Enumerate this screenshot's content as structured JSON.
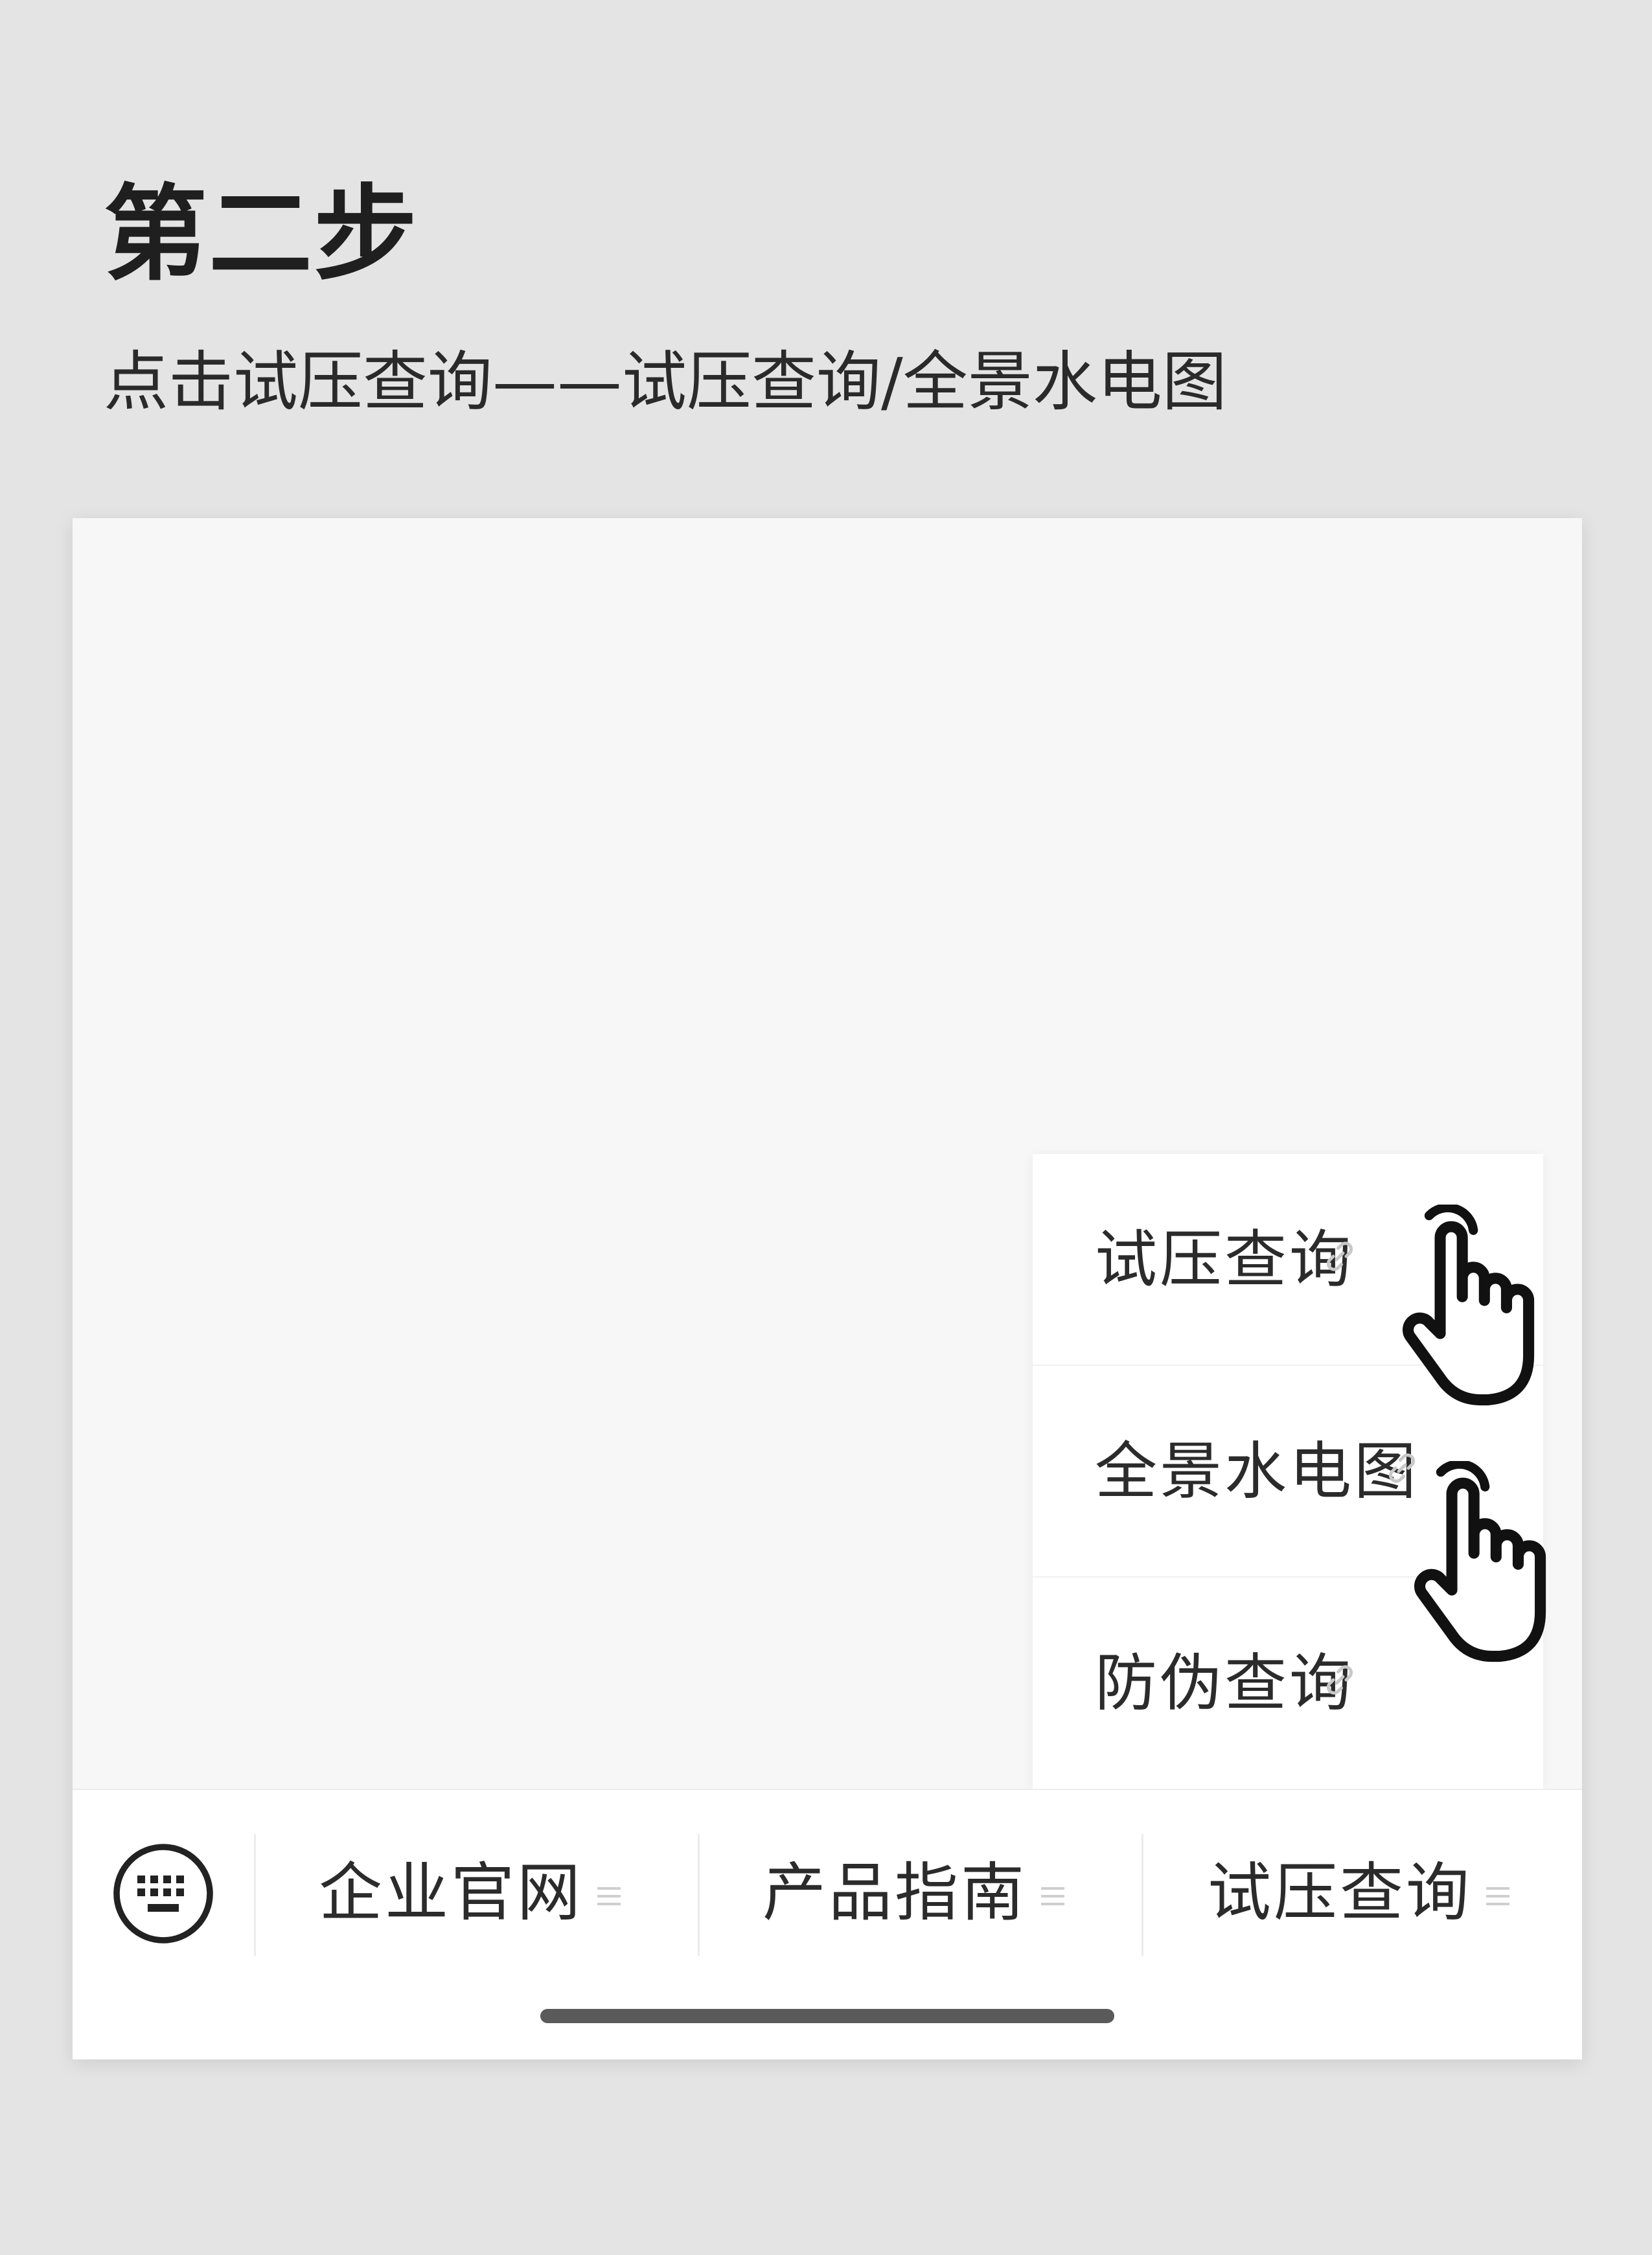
{
  "step": {
    "title": "第二步",
    "description": "点击试压查询——试压查询/全景水电图"
  },
  "popup_menu": {
    "items": [
      {
        "label": "试压查询",
        "icon": "link-icon"
      },
      {
        "label": "全景水电图",
        "icon": "link-icon"
      },
      {
        "label": "防伪查询",
        "icon": "link-icon"
      }
    ]
  },
  "bottom_menu": {
    "keyboard_icon": "keyboard-icon",
    "tabs": [
      {
        "label": "企业官网",
        "icon": "menu-lines-icon"
      },
      {
        "label": "产品指南",
        "icon": "menu-lines-icon"
      },
      {
        "label": "试压查询",
        "icon": "menu-lines-icon"
      }
    ]
  },
  "colors": {
    "page_bg": "#e4e4e4",
    "screen_bg": "#f7f7f7",
    "popup_bg": "#ffffff",
    "text": "#2b2b2b",
    "home_indicator": "#5a5a5a"
  }
}
